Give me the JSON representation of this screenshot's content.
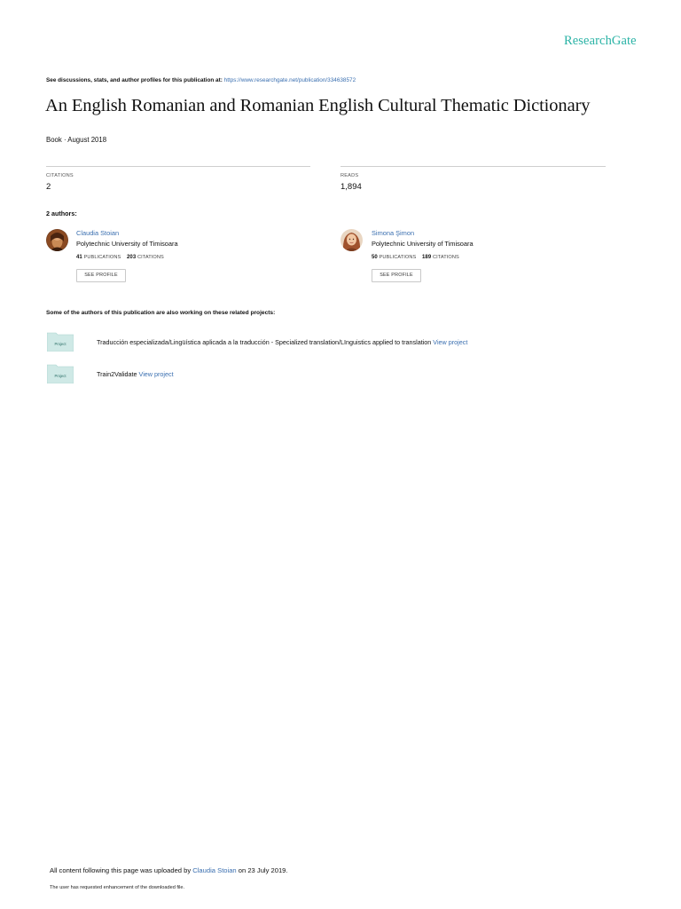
{
  "header": {
    "logo": "ResearchGate",
    "discussion_prefix": "See discussions, stats, and author profiles for this publication at: ",
    "publication_url": "https://www.researchgate.net/publication/334638572"
  },
  "publication": {
    "title": "An English Romanian and Romanian English Cultural Thematic Dictionary",
    "type_date": "Book · August 2018"
  },
  "stats": {
    "citations_label": "CITATIONS",
    "citations_value": "2",
    "reads_label": "READS",
    "reads_value": "1,894"
  },
  "authors_heading": "2 authors:",
  "authors": [
    {
      "name": "Claudia Stoian",
      "affiliation": "Polytechnic University of Timisoara",
      "publications": "41",
      "publications_label": "PUBLICATIONS",
      "citations": "203",
      "citations_label": "CITATIONS",
      "button": "SEE PROFILE"
    },
    {
      "name": "Simona Şimon",
      "affiliation": "Polytechnic University of Timisoara",
      "publications": "50",
      "publications_label": "PUBLICATIONS",
      "citations": "189",
      "citations_label": "CITATIONS",
      "button": "SEE PROFILE"
    }
  ],
  "projects_heading": "Some of the authors of this publication are also working on these related projects:",
  "projects": [
    {
      "icon_label": "Project",
      "title": "Traducción especializada/Lingüística aplicada a la traducción - Specialized translation/LInguistics applied to translation ",
      "link": "View project"
    },
    {
      "icon_label": "Project",
      "title": "Train2Validate ",
      "link": "View project"
    }
  ],
  "footer": {
    "uploaded_prefix": "All content following this page was uploaded by ",
    "uploader": "Claudia Stoian",
    "uploaded_suffix": " on 23 July 2019.",
    "note": "The user has requested enhancement of the downloaded file."
  },
  "colors": {
    "brand": "#2bb3a6",
    "link": "#3a6fb0",
    "project_icon": "#cfe9e6"
  }
}
